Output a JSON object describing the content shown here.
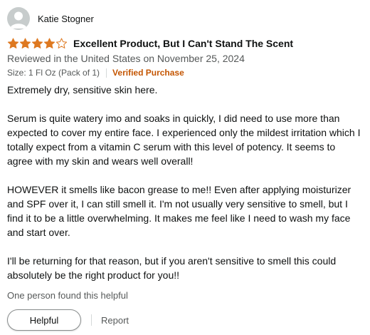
{
  "reviewer": {
    "name": "Katie Stogner"
  },
  "review": {
    "rating": 4,
    "rating_max": 5,
    "title": "Excellent Product, But I Can't Stand The Scent",
    "date_text": "Reviewed in the United States on November 25, 2024",
    "variant": "Size: 1 Fl Oz (Pack of 1)",
    "verified_label": "Verified Purchase",
    "paragraphs": [
      "Extremely dry, sensitive skin here.",
      "Serum is quite watery imo and soaks in quickly, I did need to use more than expected to cover my entire face. I experienced only the mildest irritation which I totally expect from a vitamin C serum with this level of potency. It seems to agree with my skin and wears well overall!",
      "HOWEVER it smells like bacon grease to me!! Even after applying moisturizer and SPF over it, I can still smell it. I'm not usually very sensitive to smell, but I find it to be a little overwhelming. It makes me feel like I need to wash my face and start over.",
      "I'll be returning for that reason, but if you aren't sensitive to smell this could absolutely be the right product for you!!"
    ],
    "helpful_count_text": "One person found this helpful"
  },
  "actions": {
    "helpful_label": "Helpful",
    "report_label": "Report"
  },
  "colors": {
    "star_fill": "#de7921",
    "verified": "#c45500",
    "secondary_text": "#565959",
    "avatar_bg": "#c7cccc"
  },
  "icons": {
    "avatar": "default-profile-icon",
    "star": "star-icon"
  }
}
